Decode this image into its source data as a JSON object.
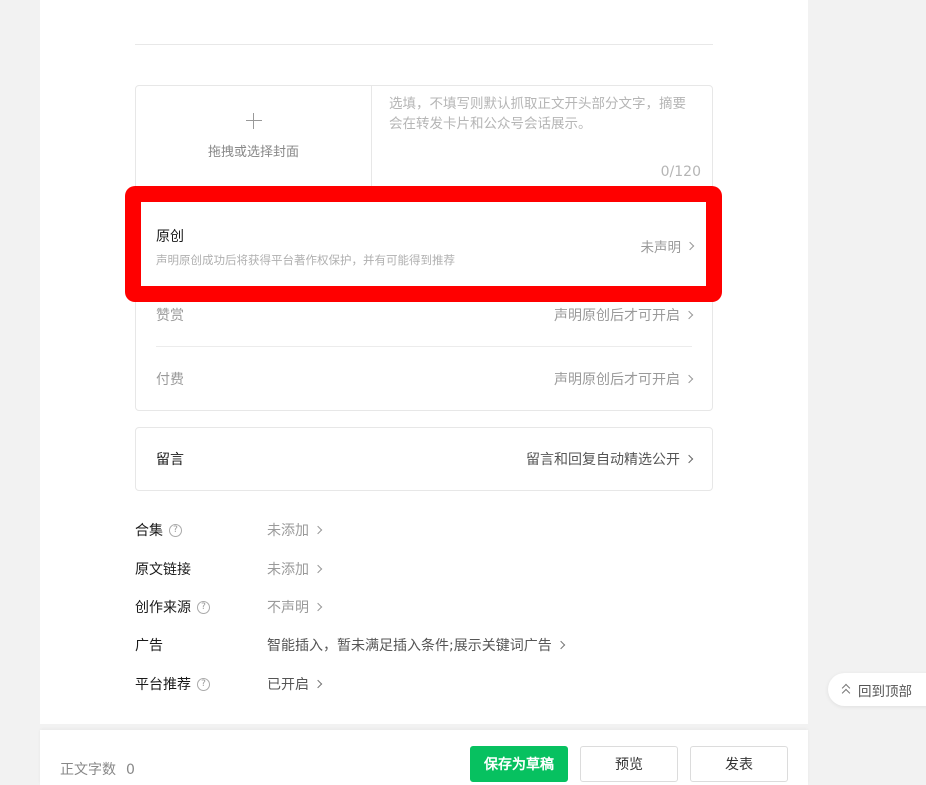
{
  "cover": {
    "upload_label": "拖拽或选择封面",
    "summary_placeholder": "选填，不填写则默认抓取正文开头部分文字，摘要会在转发卡片和公众号会话展示。",
    "summary_count": "0/120"
  },
  "original": {
    "title": "原创",
    "description": "声明原创成功后将获得平台著作权保护，并有可能得到推荐",
    "status": "未声明"
  },
  "reward": {
    "title": "赞赏",
    "status": "声明原创后才可开启"
  },
  "paid": {
    "title": "付费",
    "status": "声明原创后才可开启"
  },
  "comment": {
    "title": "留言",
    "status": "留言和回复自动精选公开"
  },
  "meta": [
    {
      "label": "合集",
      "value": "未添加",
      "help": true
    },
    {
      "label": "原文链接",
      "value": "未添加",
      "help": false
    },
    {
      "label": "创作来源",
      "value": "不声明",
      "help": true
    },
    {
      "label": "广告",
      "value": "智能插入，暂未满足插入条件;展示关键词广告",
      "help": false
    },
    {
      "label": "平台推荐",
      "value": "已开启",
      "help": true
    }
  ],
  "help_glyph": "?",
  "back_to_top": "回到顶部",
  "footer": {
    "word_count_label": "正文字数",
    "word_count": "0",
    "save_draft": "保存为草稿",
    "preview": "预览",
    "publish": "发表"
  },
  "colors": {
    "primary_green": "#07c160",
    "highlight_red": "#ff0000"
  },
  "icons": [
    "plus-icon",
    "chevron-right-icon",
    "help-circle-icon",
    "double-chevron-up-icon"
  ]
}
